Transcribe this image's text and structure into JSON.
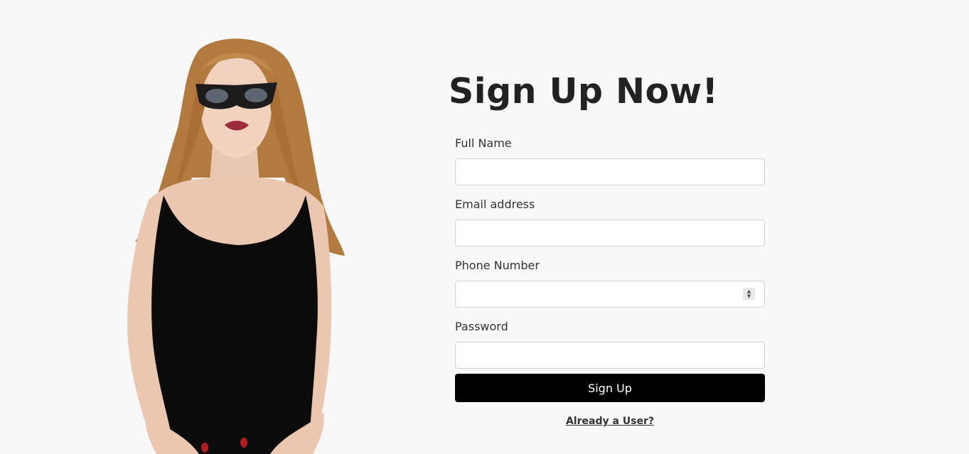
{
  "title": "Sign Up Now!",
  "form": {
    "full_name": {
      "label": "Full Name",
      "value": "",
      "placeholder": ""
    },
    "email": {
      "label": "Email address",
      "value": "",
      "placeholder": ""
    },
    "phone": {
      "label": "Phone Number",
      "value": "",
      "placeholder": ""
    },
    "password": {
      "label": "Password",
      "value": "",
      "placeholder": ""
    },
    "submit_label": "Sign Up",
    "login_link": "Already a User?"
  },
  "icons": {
    "spinner_up": "chevron-up-icon",
    "spinner_down": "chevron-down-icon"
  },
  "colors": {
    "background": "#f8f8f8",
    "button": "#000000",
    "button_text": "#ffffff",
    "text": "#222222",
    "input_border": "#ced4da"
  }
}
